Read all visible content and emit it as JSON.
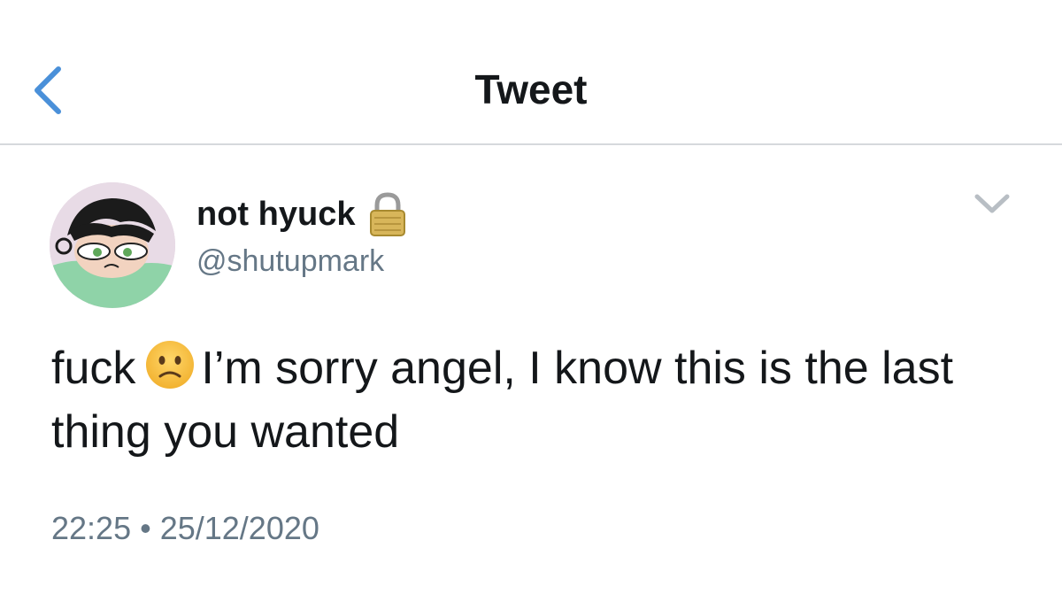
{
  "nav": {
    "title": "Tweet",
    "back_icon": "chevron-left-icon"
  },
  "tweet": {
    "author_name": "not hyuck",
    "handle": "@shutupmark",
    "lock_icon": "lock-icon",
    "menu_icon": "chevron-down-icon",
    "text_before_emoji": "fuck",
    "emoji": "slightly-frowning-face",
    "text_after_emoji": "I’m sorry angel, I know this is the last thing you wanted",
    "time": "22:25",
    "separator": "•",
    "date": "25/12/2020"
  },
  "colors": {
    "accent": "#4a90d9",
    "text": "#14171a",
    "secondary": "#657786",
    "divider": "#d6d9dc"
  }
}
